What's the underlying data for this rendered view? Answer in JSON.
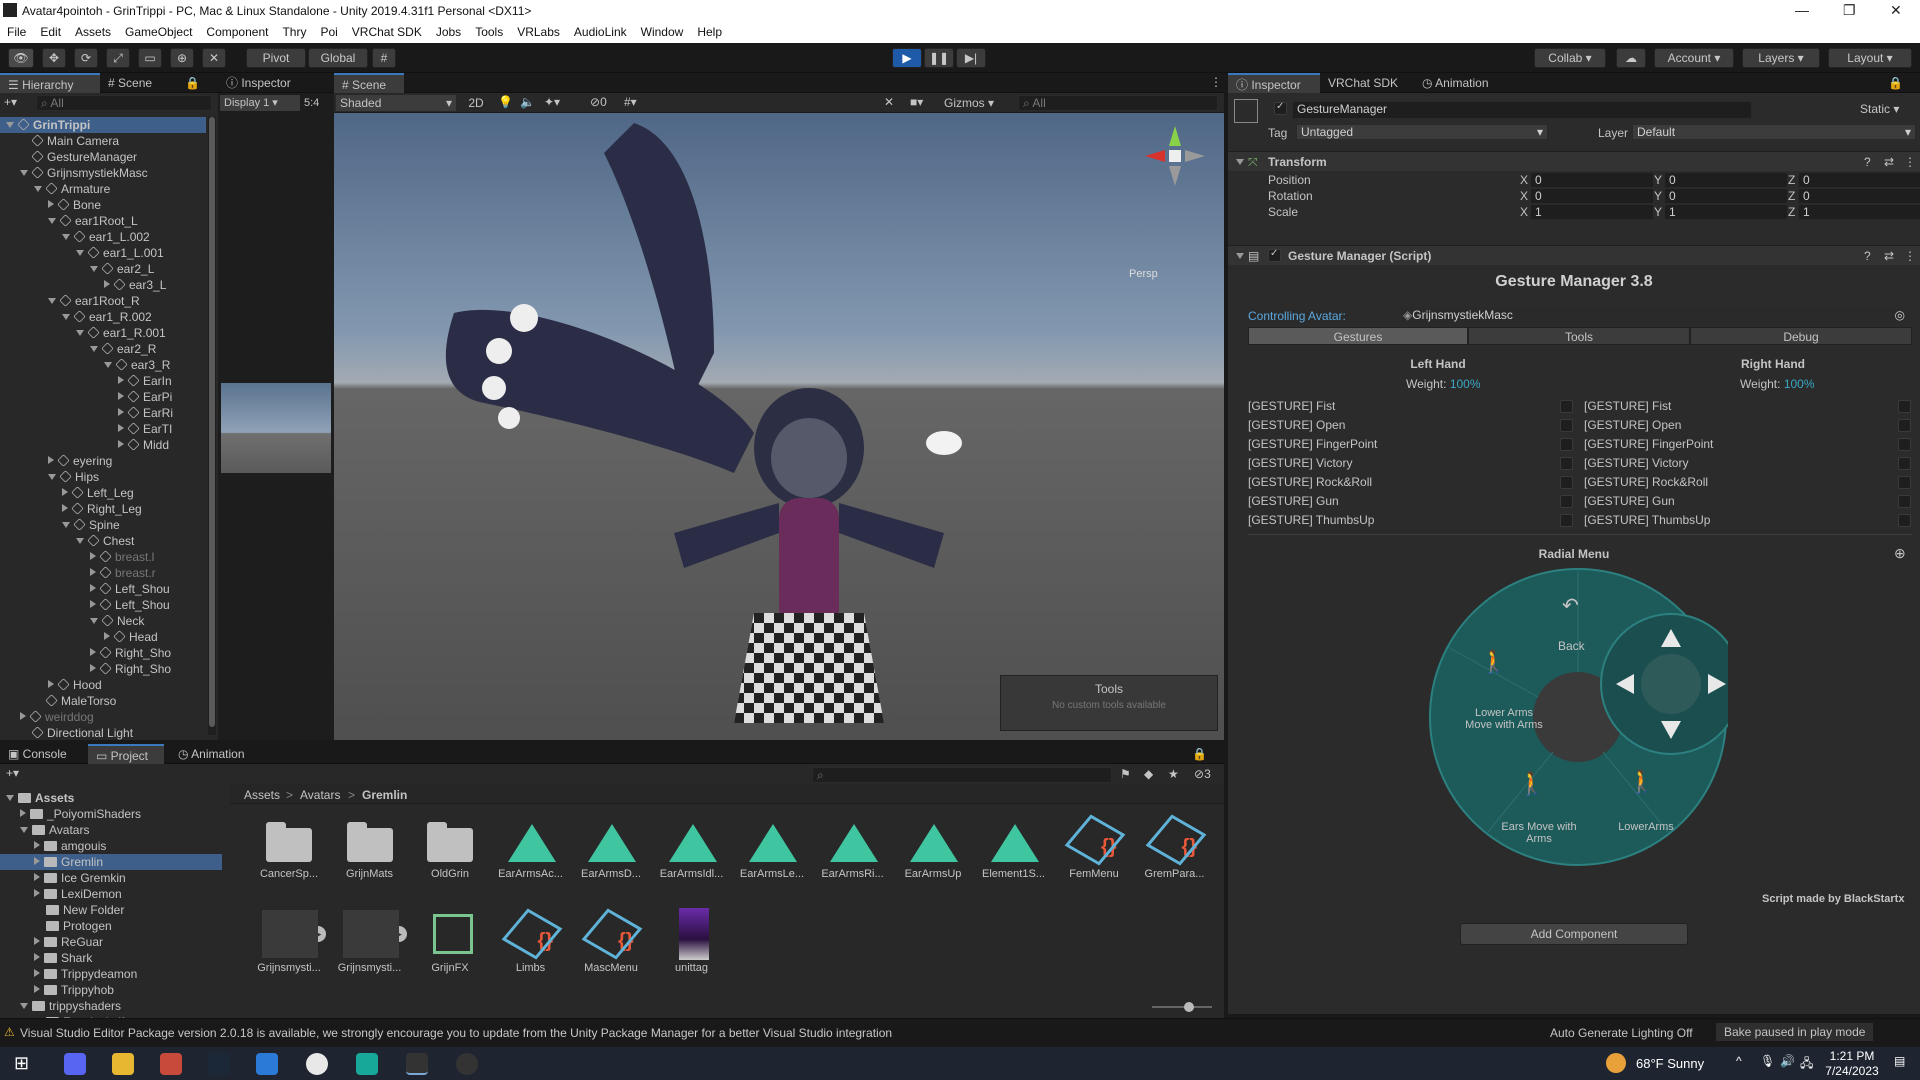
{
  "window": {
    "title": "Avatar4pointoh - GrinTrippi - PC, Mac & Linux Standalone - Unity 2019.4.31f1 Personal <DX11>"
  },
  "menu": [
    "File",
    "Edit",
    "Assets",
    "GameObject",
    "Component",
    "Thry",
    "Poi",
    "VRChat SDK",
    "Jobs",
    "Tools",
    "VRLabs",
    "AudioLink",
    "Window",
    "Help"
  ],
  "toolbar": {
    "pivot": "Pivot",
    "global": "Global",
    "collab": "Collab",
    "account": "Account",
    "layers": "Layers",
    "layout": "Layout"
  },
  "hierarchy": {
    "tabs": [
      "Hierarchy",
      "Scene"
    ],
    "search_placeholder": "All",
    "rows": [
      {
        "label": "GrinTrippi",
        "indent": 0,
        "arrow": "down",
        "selected": true
      },
      {
        "label": "Main Camera",
        "indent": 1,
        "arrow": "none"
      },
      {
        "label": "GestureManager",
        "indent": 1,
        "arrow": "none"
      },
      {
        "label": "GrijnsmystiekMasc",
        "indent": 1,
        "arrow": "down"
      },
      {
        "label": "Armature",
        "indent": 2,
        "arrow": "down"
      },
      {
        "label": "Bone",
        "indent": 3,
        "arrow": "right"
      },
      {
        "label": "ear1Root_L",
        "indent": 3,
        "arrow": "down"
      },
      {
        "label": "ear1_L.002",
        "indent": 4,
        "arrow": "down"
      },
      {
        "label": "ear1_L.001",
        "indent": 5,
        "arrow": "down"
      },
      {
        "label": "ear2_L",
        "indent": 6,
        "arrow": "down"
      },
      {
        "label": "ear3_L",
        "indent": 7,
        "arrow": "right"
      },
      {
        "label": "ear1Root_R",
        "indent": 3,
        "arrow": "down"
      },
      {
        "label": "ear1_R.002",
        "indent": 4,
        "arrow": "down"
      },
      {
        "label": "ear1_R.001",
        "indent": 5,
        "arrow": "down"
      },
      {
        "label": "ear2_R",
        "indent": 6,
        "arrow": "down"
      },
      {
        "label": "ear3_R",
        "indent": 7,
        "arrow": "down"
      },
      {
        "label": "EarIn",
        "indent": 8,
        "arrow": "right"
      },
      {
        "label": "EarPi",
        "indent": 8,
        "arrow": "right"
      },
      {
        "label": "EarRi",
        "indent": 8,
        "arrow": "right"
      },
      {
        "label": "EarTI",
        "indent": 8,
        "arrow": "right"
      },
      {
        "label": "Midd",
        "indent": 8,
        "arrow": "right"
      },
      {
        "label": "eyering",
        "indent": 3,
        "arrow": "right"
      },
      {
        "label": "Hips",
        "indent": 3,
        "arrow": "down"
      },
      {
        "label": "Left_Leg",
        "indent": 4,
        "arrow": "right"
      },
      {
        "label": "Right_Leg",
        "indent": 4,
        "arrow": "right"
      },
      {
        "label": "Spine",
        "indent": 4,
        "arrow": "down"
      },
      {
        "label": "Chest",
        "indent": 5,
        "arrow": "down"
      },
      {
        "label": "breast.l",
        "indent": 6,
        "arrow": "right",
        "dim": true
      },
      {
        "label": "breast.r",
        "indent": 6,
        "arrow": "right",
        "dim": true
      },
      {
        "label": "Left_Shou",
        "indent": 6,
        "arrow": "right"
      },
      {
        "label": "Left_Shou",
        "indent": 6,
        "arrow": "right"
      },
      {
        "label": "Neck",
        "indent": 6,
        "arrow": "down"
      },
      {
        "label": "Head",
        "indent": 7,
        "arrow": "right"
      },
      {
        "label": "Right_Sho",
        "indent": 6,
        "arrow": "right"
      },
      {
        "label": "Right_Sho",
        "indent": 6,
        "arrow": "right"
      },
      {
        "label": "Hood",
        "indent": 3,
        "arrow": "right"
      },
      {
        "label": "MaleTorso",
        "indent": 2,
        "arrow": "none"
      },
      {
        "label": "weirddog",
        "indent": 1,
        "arrow": "right",
        "dim": true
      },
      {
        "label": "Directional Light",
        "indent": 1,
        "arrow": "none"
      }
    ]
  },
  "inspector_small": {
    "tab": "Inspector",
    "display": "Display 1",
    "aspect": "5:4"
  },
  "scene": {
    "tab": "Scene",
    "shading": "Shaded",
    "mode2d": "2D",
    "gizmos": "Gizmos",
    "search_placeholder": "All",
    "persp": "Persp",
    "fx_count": "0",
    "tools_title": "Tools",
    "tools_note": "No custom tools available"
  },
  "inspector": {
    "tabs": [
      "Inspector",
      "VRChat SDK",
      "Animation"
    ],
    "object_name": "GestureManager",
    "static_label": "Static",
    "tag_label": "Tag",
    "tag_value": "Untagged",
    "layer_label": "Layer",
    "layer_value": "Default",
    "transform": {
      "title": "Transform",
      "rows": [
        {
          "label": "Position",
          "x": "0",
          "y": "0",
          "z": "0"
        },
        {
          "label": "Rotation",
          "x": "0",
          "y": "0",
          "z": "0"
        },
        {
          "label": "Scale",
          "x": "1",
          "y": "1",
          "z": "1"
        }
      ]
    },
    "script_title": "Gesture Manager (Script)",
    "gm": {
      "title": "Gesture Manager 3.8",
      "controlling_label": "Controlling Avatar:",
      "controlling_value": "GrijnsmystiekMasc",
      "tabs": [
        "Gestures",
        "Tools",
        "Debug"
      ],
      "left_hand": "Left Hand",
      "right_hand": "Right Hand",
      "weight_label": "Weight:",
      "left_weight": "100%",
      "right_weight": "100%",
      "gestures": [
        "[GESTURE] Fist",
        "[GESTURE] Open",
        "[GESTURE] FingerPoint",
        "[GESTURE] Victory",
        "[GESTURE] Rock&Roll",
        "[GESTURE] Gun",
        "[GESTURE] ThumbsUp"
      ],
      "radial_title": "Radial Menu",
      "radial": {
        "back": "Back",
        "lower_arms_move": "Lower Arms Move with Arms",
        "lower_arms_move_l1": "Lower Arms",
        "lower_arms_move_l2": "Move with Arms",
        "ears_move_l1": "Ears Move with",
        "ears_move_l2": "Arms",
        "lower_arms": "LowerArms"
      },
      "credit": "Script made by BlackStartx"
    },
    "add_component": "Add Component"
  },
  "bottom": {
    "tabs": [
      "Console",
      "Project",
      "Animation"
    ],
    "search_placeholder": "",
    "hidden_count": "3",
    "breadcrumb": [
      "Assets",
      "Avatars",
      "Gremlin"
    ],
    "tree": [
      {
        "label": "Assets",
        "indent": 0,
        "arrow": "down",
        "bold": true
      },
      {
        "label": "_PoiyomiShaders",
        "indent": 1,
        "arrow": "right"
      },
      {
        "label": "Avatars",
        "indent": 1,
        "arrow": "down"
      },
      {
        "label": "amgouis",
        "indent": 2,
        "arrow": "right"
      },
      {
        "label": "Gremlin",
        "indent": 2,
        "arrow": "right",
        "selected": true
      },
      {
        "label": "Ice Gremkin",
        "indent": 2,
        "arrow": "right"
      },
      {
        "label": "LexiDemon",
        "indent": 2,
        "arrow": "right"
      },
      {
        "label": "New Folder",
        "indent": 2,
        "arrow": "none"
      },
      {
        "label": "Protogen",
        "indent": 2,
        "arrow": "none"
      },
      {
        "label": "ReGuar",
        "indent": 2,
        "arrow": "right"
      },
      {
        "label": "Shark",
        "indent": 2,
        "arrow": "right"
      },
      {
        "label": "Trippydeamon",
        "indent": 2,
        "arrow": "right"
      },
      {
        "label": "Trippyhob",
        "indent": 2,
        "arrow": "right"
      },
      {
        "label": "trippyshaders",
        "indent": 1,
        "arrow": "down"
      },
      {
        "label": "Fractical gifs",
        "indent": 2,
        "arrow": "none"
      }
    ],
    "assets_row1": [
      {
        "label": "CancerSp...",
        "kind": "folder"
      },
      {
        "label": "GrijnMats",
        "kind": "folder"
      },
      {
        "label": "OldGrin",
        "kind": "folder"
      },
      {
        "label": "EarArmsAc...",
        "kind": "anim"
      },
      {
        "label": "EarArmsD...",
        "kind": "anim"
      },
      {
        "label": "EarArmsIdl...",
        "kind": "anim"
      },
      {
        "label": "EarArmsLe...",
        "kind": "anim"
      },
      {
        "label": "EarArmsRi...",
        "kind": "anim"
      },
      {
        "label": "EarArmsUp",
        "kind": "anim"
      },
      {
        "label": "Element1S...",
        "kind": "anim"
      },
      {
        "label": "FemMenu",
        "kind": "menu"
      },
      {
        "label": "GremPara...",
        "kind": "menu"
      }
    ],
    "assets_row2": [
      {
        "label": "Grijnsmysti...",
        "kind": "prefab"
      },
      {
        "label": "Grijnsmysti...",
        "kind": "prefab"
      },
      {
        "label": "GrijnFX",
        "kind": "controller"
      },
      {
        "label": "Limbs",
        "kind": "menu"
      },
      {
        "label": "MascMenu",
        "kind": "menu"
      },
      {
        "label": "unittag",
        "kind": "image"
      }
    ]
  },
  "status": {
    "warning": "Visual Studio Editor Package version 2.0.18 is available, we strongly encourage you to update from the Unity Package Manager for a better Visual Studio integration",
    "lighting": "Auto Generate Lighting Off",
    "bake": "Bake paused in play mode"
  },
  "taskbar": {
    "weather": "68°F  Sunny",
    "time": "1:21 PM",
    "date": "7/24/2023"
  },
  "colors": {
    "accent": "#3a79bb",
    "play": "#1e5aa8",
    "teal": "#3fc6a0",
    "radial": "#1b4f4f",
    "weight": "#3aa8c4"
  }
}
